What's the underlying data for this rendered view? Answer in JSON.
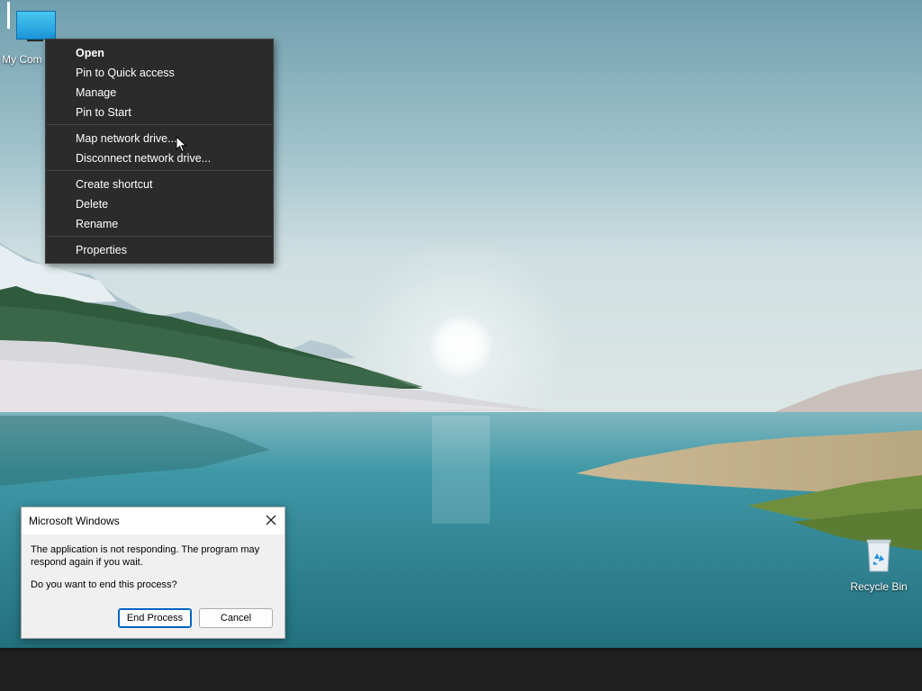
{
  "desktop": {
    "icons": [
      {
        "label": "My Com",
        "icon": "computer-icon"
      },
      {
        "label": "Recycle Bin",
        "icon": "recycle-bin-icon"
      }
    ]
  },
  "context_menu": {
    "items": [
      {
        "label": "Open",
        "bold": true
      },
      {
        "label": "Pin to Quick access"
      },
      {
        "label": "Manage"
      },
      {
        "label": "Pin to Start"
      },
      {
        "label": "Map network drive..."
      },
      {
        "label": "Disconnect network drive..."
      },
      {
        "label": "Create shortcut"
      },
      {
        "label": "Delete"
      },
      {
        "label": "Rename"
      },
      {
        "label": "Properties"
      }
    ]
  },
  "dialog": {
    "title": "Microsoft Windows",
    "message": "The application is not responding. The program may respond again if you wait.",
    "question": "Do you want to end this process?",
    "primary_button": "End Process",
    "cancel_button": "Cancel"
  },
  "colors": {
    "menu_bg": "#2b2b2b",
    "taskbar_bg": "#202020",
    "accent": "#0067c0"
  }
}
